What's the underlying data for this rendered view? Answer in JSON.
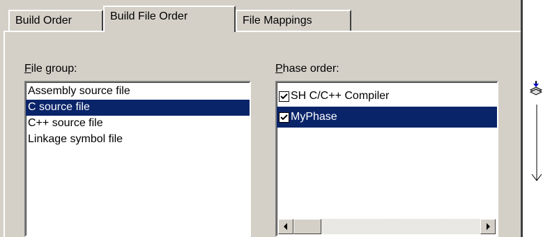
{
  "tabs": [
    {
      "label": "Build Order"
    },
    {
      "label": "Build File Order"
    },
    {
      "label": "File Mappings"
    }
  ],
  "file_group": {
    "label_mnemonic": "F",
    "label_rest": "ile group:",
    "items": [
      {
        "label": "Assembly source file",
        "selected": false
      },
      {
        "label": "C source file",
        "selected": true
      },
      {
        "label": "C++ source file",
        "selected": false
      },
      {
        "label": "Linkage symbol file",
        "selected": false
      }
    ]
  },
  "phase_order": {
    "label_mnemonic": "P",
    "label_rest": "hase order:",
    "items": [
      {
        "label": "SH C/C++ Compiler",
        "checked": true,
        "selected": false
      },
      {
        "label": "MyPhase",
        "checked": true,
        "selected": true
      }
    ]
  },
  "icons": {
    "move_icon": "stack-arrow-icon",
    "down_arrow": "down-arrow-icon"
  },
  "colors": {
    "dialog_bg": "#d4d0c8",
    "selection": "#0a246a"
  }
}
